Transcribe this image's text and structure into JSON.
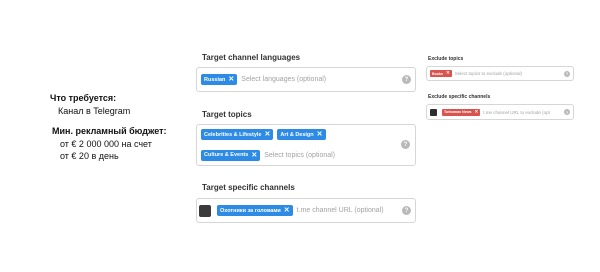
{
  "left": {
    "requirement_title": "Что требуется:",
    "requirement_value": "Канал в Telegram",
    "budget_title": "Мин. рекламный бюджет:",
    "budget_line1": "от € 2 000 000 на счет",
    "budget_line2": "от € 20 в день"
  },
  "languages": {
    "title": "Target channel languages",
    "chips": [
      "Russian"
    ],
    "placeholder": "Select languages (optional)"
  },
  "topics": {
    "title": "Target topics",
    "chips": [
      "Celebrities & Lifestyle",
      "Art & Design",
      "Culture & Events"
    ],
    "placeholder": "Select topics (optional)"
  },
  "channels": {
    "title": "Target specific channels",
    "chips": [
      "Охотники за головами"
    ],
    "placeholder": "t.me channel URL (optional)"
  },
  "exclude_topics": {
    "title": "Exclude topics",
    "chips": [
      "Books"
    ],
    "placeholder": "Select topics to exclude (optional)"
  },
  "exclude_channels": {
    "title": "Exclude specific channels",
    "chips": [
      "Turbomax News"
    ],
    "placeholder": "t.me channel URL to exclude (opt"
  },
  "icons": {
    "help": "?",
    "remove": "✕"
  }
}
